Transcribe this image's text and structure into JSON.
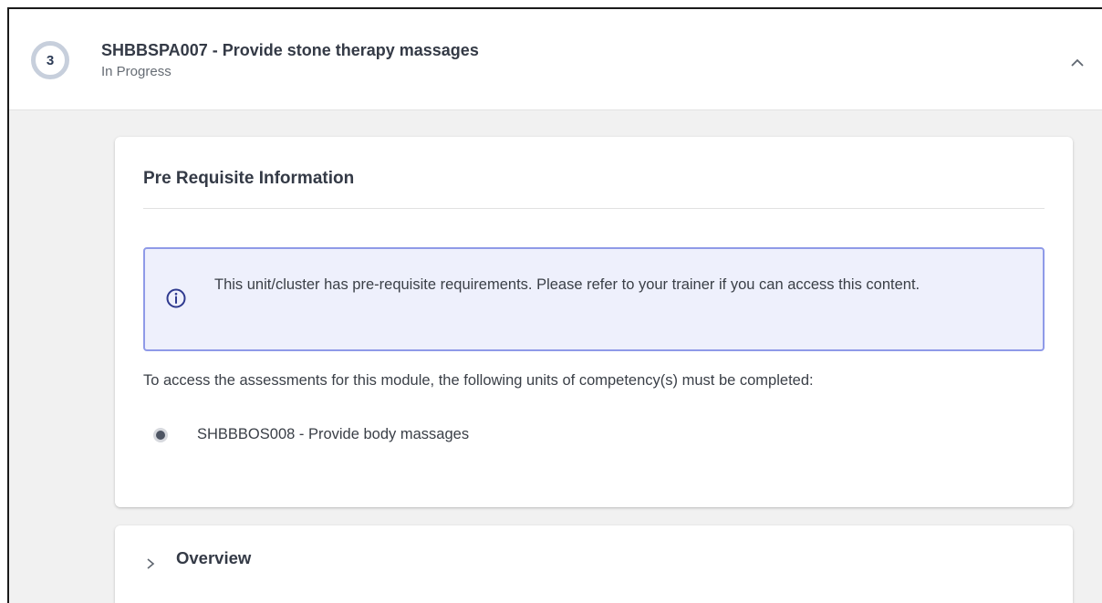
{
  "unit": {
    "step_number": "3",
    "title": "SHBBSPA007 - Provide stone therapy massages",
    "status": "In Progress",
    "collapse_icon": "chevron-up-icon"
  },
  "prerequisite": {
    "heading": "Pre Requisite Information",
    "notice": {
      "icon": "info-icon",
      "text": "This unit/cluster has pre-requisite requirements. Please refer to your trainer if you can access this content.",
      "border_color": "#8f9ae8",
      "background_color": "#eef0fc"
    },
    "intro": "To access the assessments for this module, the following units of competency(s) must be completed:",
    "required_units": [
      {
        "label": "SHBBBOS008 - Provide body massages"
      }
    ]
  },
  "overview": {
    "label": "Overview",
    "icon": "chevron-right-icon"
  }
}
